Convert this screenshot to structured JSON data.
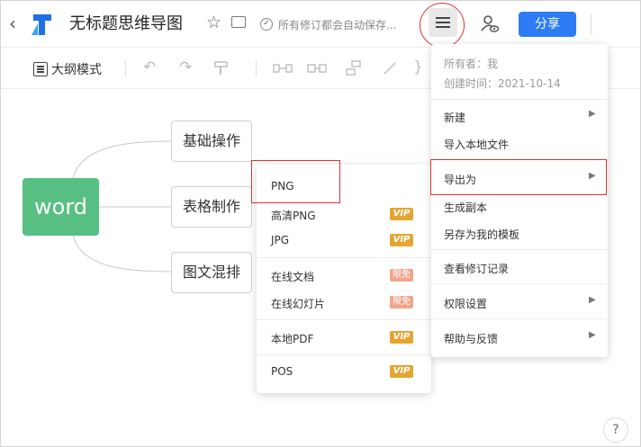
{
  "header": {
    "back_glyph": "‹",
    "title": "无标题思维导图",
    "save_status": "所有修订都会自动保存...",
    "share_label": "分享"
  },
  "toolbar": {
    "outline_mode_label": "大纲模式"
  },
  "mindmap": {
    "root": "word",
    "children": [
      "基础操作",
      "表格制作",
      "图文混排"
    ],
    "colors": {
      "root": "#58bf83"
    }
  },
  "export_menu": {
    "items": [
      {
        "label": "PNG",
        "badge": ""
      },
      {
        "label": "高清PNG",
        "badge": "VIP"
      },
      {
        "label": "JPG",
        "badge": "VIP"
      },
      {
        "label": "在线文档",
        "badge": "限免"
      },
      {
        "label": "在线幻灯片",
        "badge": "限免"
      },
      {
        "label": "本地PDF",
        "badge": "VIP"
      },
      {
        "label": "POS",
        "badge": "VIP"
      }
    ]
  },
  "main_menu": {
    "owner": "所有者：我",
    "created": "创建时间：2021-10-14",
    "items": [
      {
        "label": "新建",
        "has_submenu": true
      },
      {
        "label": "导入本地文件",
        "has_submenu": false
      },
      {
        "label": "导出为",
        "has_submenu": true
      },
      {
        "label": "生成副本",
        "has_submenu": false
      },
      {
        "label": "另存为我的模板",
        "has_submenu": false
      },
      {
        "label": "查看修订记录",
        "has_submenu": false
      },
      {
        "label": "权限设置",
        "has_submenu": true
      },
      {
        "label": "帮助与反馈",
        "has_submenu": true
      }
    ]
  },
  "help_label": "?",
  "icons": [
    "back-icon",
    "logo-icon",
    "star-icon",
    "folder-icon",
    "check-circle-icon",
    "menu-icon",
    "share-user-icon",
    "outline-icon",
    "undo-icon",
    "redo-icon",
    "format-painter-icon",
    "chevron-right-icon",
    "help-icon"
  ],
  "colors": {
    "accent": "#2d7cf6",
    "highlight_ring": "#d8342f",
    "vip_badge": "#e5a530",
    "free_badge": "#f2a58e"
  }
}
